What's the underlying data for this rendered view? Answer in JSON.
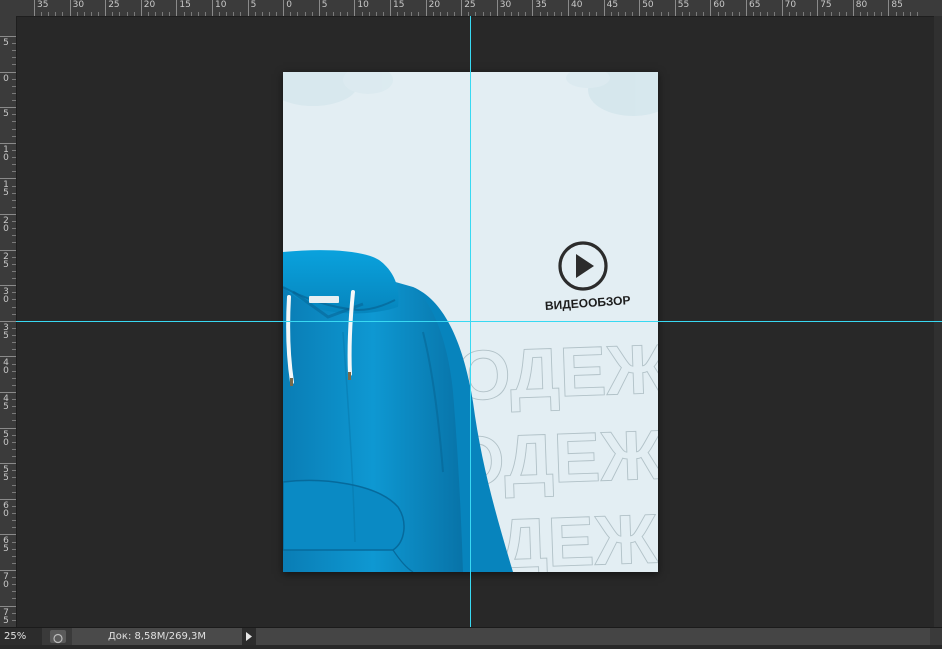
{
  "ruler": {
    "top_labels": [
      "35",
      "30",
      "25",
      "20",
      "15",
      "10",
      "5",
      "0",
      "5",
      "10",
      "15",
      "20",
      "25",
      "30",
      "35",
      "40",
      "45",
      "50",
      "55",
      "60",
      "65",
      "70",
      "75",
      "80",
      "85"
    ],
    "left_labels": [
      "5",
      "0",
      "5",
      "10",
      "15",
      "20",
      "25",
      "30",
      "35",
      "40",
      "45",
      "50",
      "55",
      "60",
      "65",
      "70",
      "75"
    ]
  },
  "canvas": {
    "video_label": "ВИДЕООБЗОР",
    "bg_word": "ОДЕЖДА",
    "colors": {
      "doc_bg": "#e3eef3",
      "hoodie": "#0c8fc7",
      "guide": "#38d9f2"
    }
  },
  "status": {
    "zoom": "25%",
    "doc_info": "Док: 8,58M/269,3M"
  }
}
